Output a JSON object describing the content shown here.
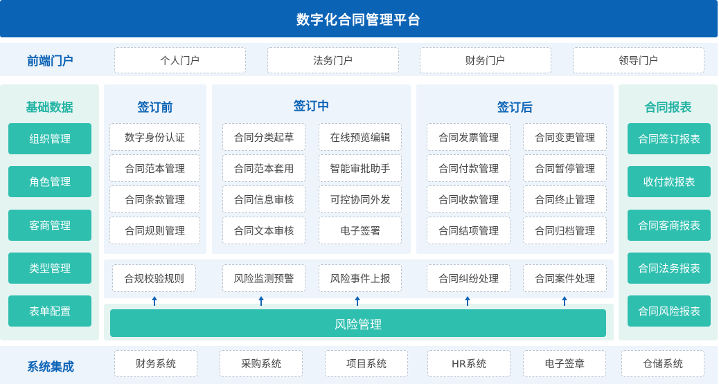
{
  "title": "数字化合同管理平台",
  "frontend": {
    "label": "前端门户",
    "items": [
      "个人门户",
      "法务门户",
      "财务门户",
      "领导门户"
    ]
  },
  "base_data": {
    "label": "基础数据",
    "items": [
      "组织管理",
      "角色管理",
      "客商管理",
      "类型管理",
      "表单配置"
    ]
  },
  "before_sign": {
    "label": "签订前",
    "items": [
      "数字身份认证",
      "合同范本管理",
      "合同条款管理",
      "合同规则管理"
    ]
  },
  "during_sign": {
    "label": "签订中",
    "left": [
      "合同分类起草",
      "合同范本套用",
      "合同信息审核",
      "合同文本审核"
    ],
    "right": [
      "在线预览编辑",
      "智能审批助手",
      "可控协同外发",
      "电子签署"
    ]
  },
  "after_sign": {
    "label": "签订后",
    "left": [
      "合同发票管理",
      "合同付款管理",
      "合同收款管理",
      "合同结项管理"
    ],
    "right": [
      "合同变更管理",
      "合同暂停管理",
      "合同终止管理",
      "合同归档管理"
    ]
  },
  "reports": {
    "label": "合同报表",
    "items": [
      "合同签订报表",
      "收付款报表",
      "合同客商报表",
      "合同法务报表",
      "合同风险报表"
    ]
  },
  "risk": {
    "items": [
      "合规校验规则",
      "风险监测预警",
      "风险事件上报",
      "合同纠纷处理",
      "合同案件处理"
    ],
    "bar_label": "风险管理"
  },
  "integration": {
    "label": "系统集成",
    "items": [
      "财务系统",
      "采购系统",
      "项目系统",
      "HR系统",
      "电子签章",
      "仓储系统"
    ]
  },
  "colors": {
    "title_bg": "#0b63b6",
    "band_bg": "#eef4fb",
    "base_bg": "#e4f4f1",
    "teal": "#2fbfaf",
    "heading_blue": "#0b63b6",
    "heading_teal": "#22b3a3"
  }
}
